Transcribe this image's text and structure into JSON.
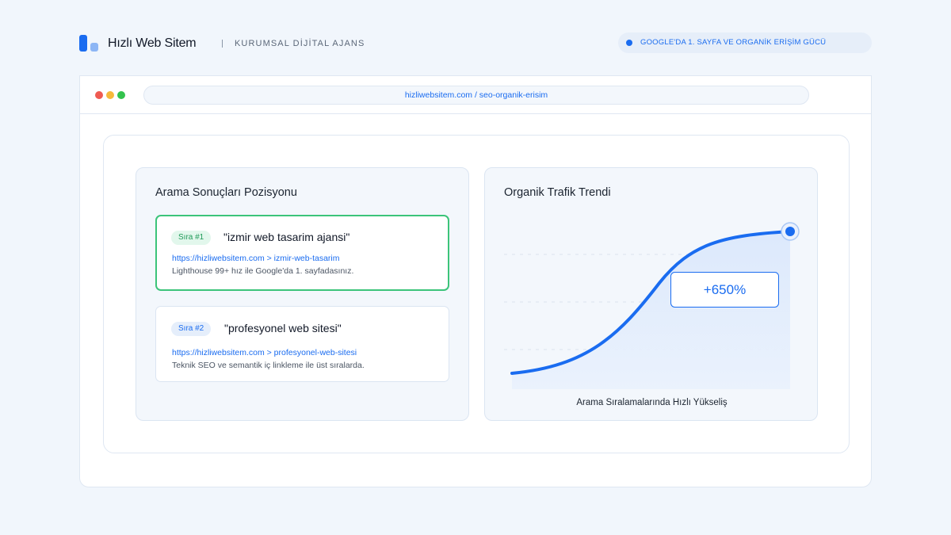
{
  "header": {
    "brand": "Hızlı Web Sitem",
    "tagline": "KURUMSAL DİJİTAL AJANS",
    "pill_text": "GOOGLE'DA 1. SAYFA VE ORGANİK ERİŞİM GÜCÜ"
  },
  "browser": {
    "url": "hizliwebsitem.com / seo-organik-erisim"
  },
  "search_card": {
    "title": "Arama Sonuçları Pozisyonu",
    "results": [
      {
        "rank": "Sıra #1",
        "query": "\"izmir web tasarim ajansi\"",
        "url": "https://hizliwebsitem.com > izmir-web-tasarim",
        "description": "Lighthouse 99+ hız ile Google'da 1. sayfadasınız."
      },
      {
        "rank": "Sıra #2",
        "query": "\"profesyonel web sitesi\"",
        "url": "https://hizliwebsitem.com > profesyonel-web-sitesi",
        "description": "Teknik SEO ve semantik iç linkleme ile üst sıralarda."
      }
    ]
  },
  "traffic_card": {
    "title": "Organik Trafik Trendi",
    "growth_label": "+650%",
    "caption": "Arama Sıralamalarında Hızlı Yükseliş"
  },
  "colors": {
    "accent": "#1a6cf0",
    "success": "#3cc47a",
    "background": "#f1f6fc"
  }
}
